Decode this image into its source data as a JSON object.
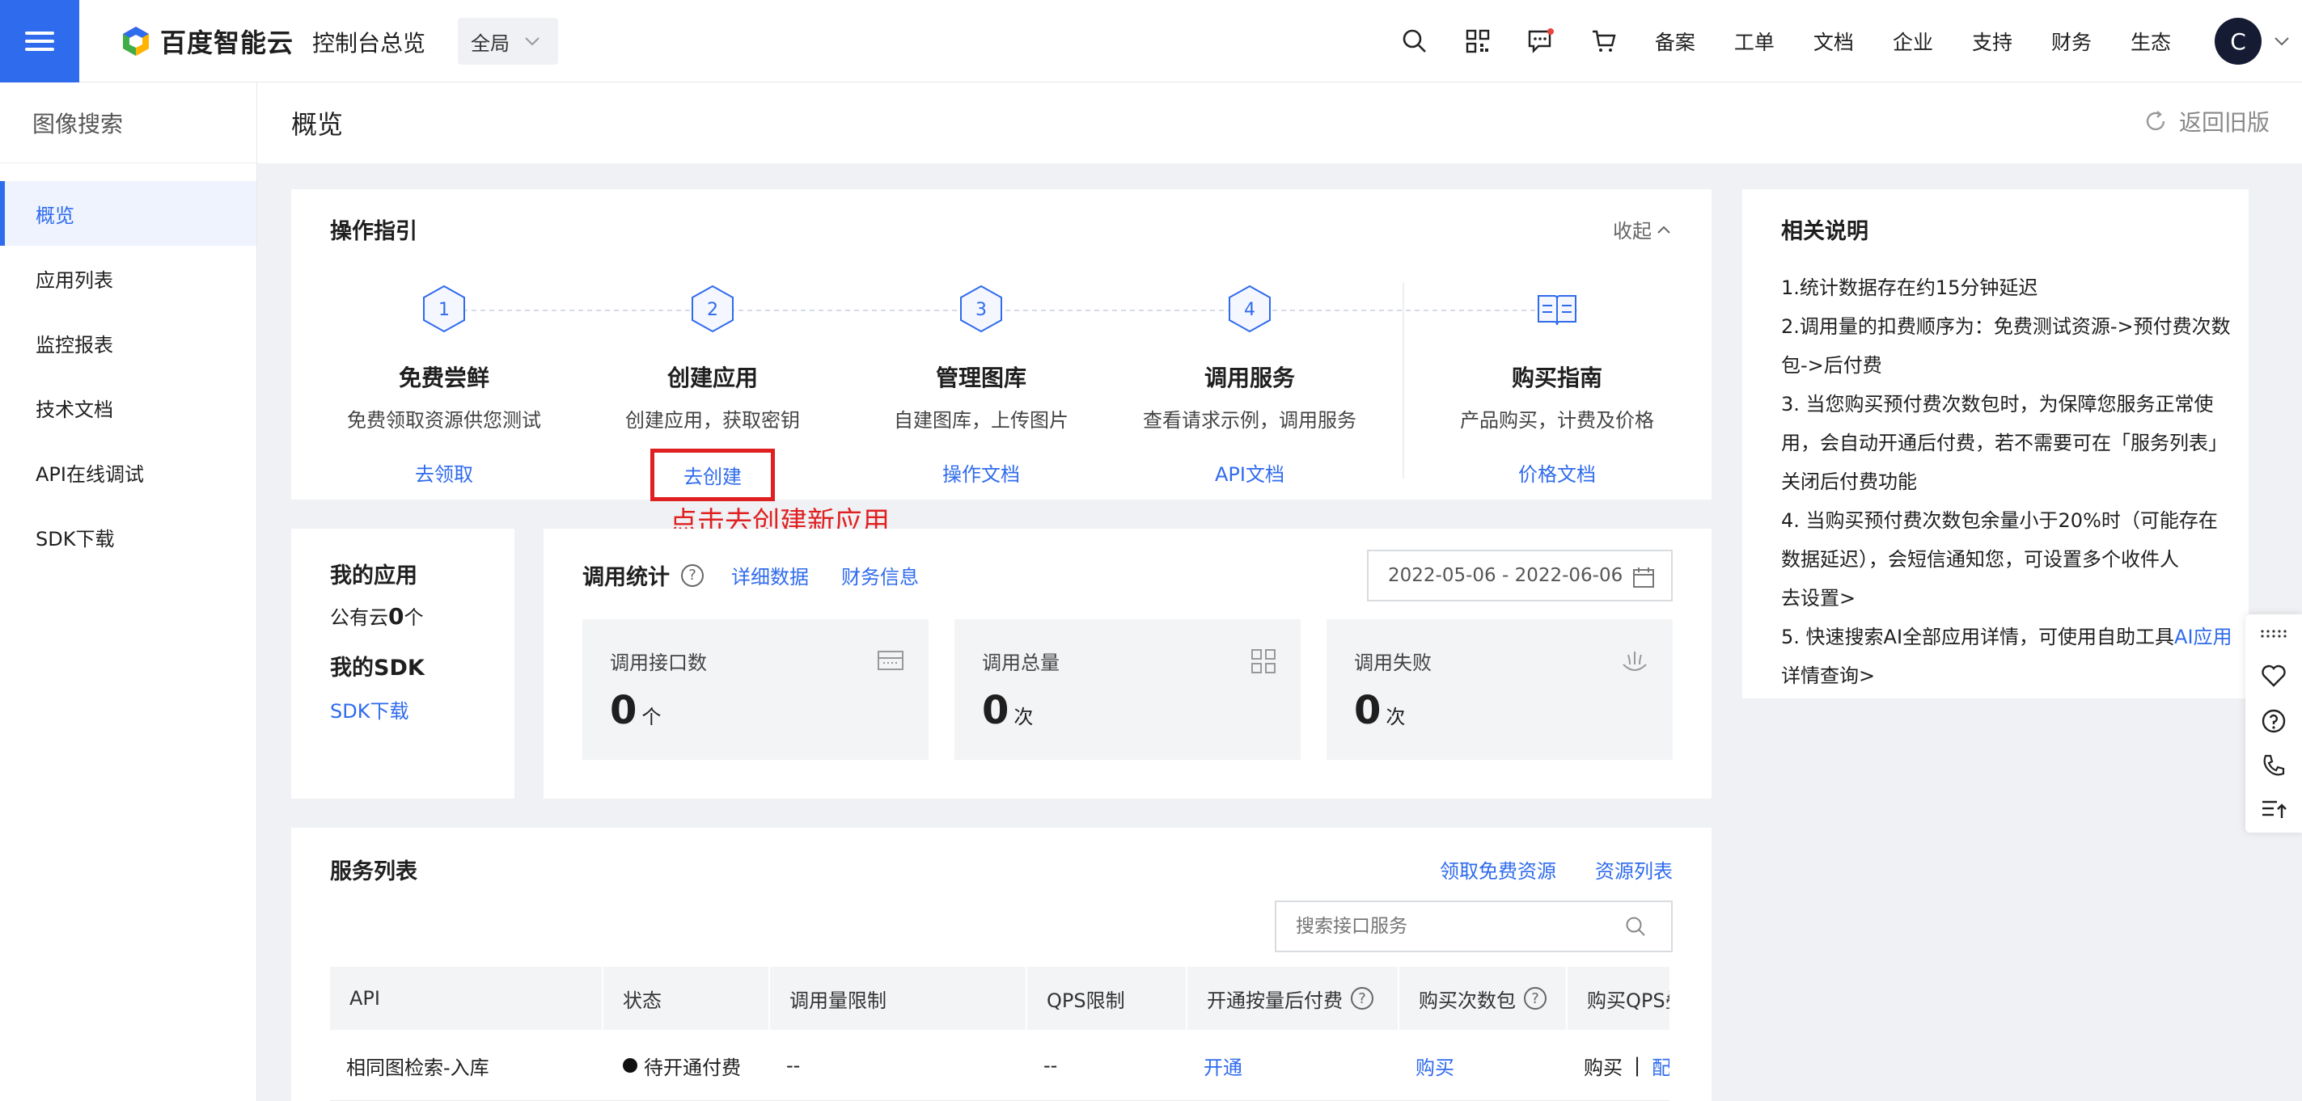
{
  "topbar": {
    "brand": "百度智能云",
    "console_label": "控制台总览",
    "region": "全局",
    "nav_links": [
      "备案",
      "工单",
      "文档",
      "企业",
      "支持",
      "财务",
      "生态"
    ],
    "avatar_letter": "C",
    "accent": "#2f6bed"
  },
  "sidebar": {
    "title": "图像搜索",
    "items": [
      {
        "label": "概览",
        "active": true
      },
      {
        "label": "应用列表"
      },
      {
        "label": "监控报表"
      },
      {
        "label": "技术文档"
      },
      {
        "label": "API在线调试"
      },
      {
        "label": "SDK下载"
      }
    ]
  },
  "page": {
    "title": "概览",
    "back_old": "返回旧版"
  },
  "guide": {
    "title": "操作指引",
    "collapse": "收起",
    "steps": [
      {
        "num": "1",
        "name": "免费尝鲜",
        "desc": "免费领取资源供您测试",
        "link": "去领取"
      },
      {
        "num": "2",
        "name": "创建应用",
        "desc": "创建应用，获取密钥",
        "link": "去创建"
      },
      {
        "num": "3",
        "name": "管理图库",
        "desc": "自建图库，上传图片",
        "link": "操作文档"
      },
      {
        "num": "4",
        "name": "调用服务",
        "desc": "查看请求示例，调用服务",
        "link": "API文档"
      }
    ],
    "purchase": {
      "name": "购买指南",
      "desc": "产品购买，计费及价格",
      "link": "价格文档"
    },
    "annotation": "点击去创建新应用"
  },
  "myapps": {
    "title": "我的应用",
    "public_cloud_prefix": "公有云",
    "public_cloud_count": "0",
    "public_cloud_unit": "个",
    "sdk_title": "我的SDK",
    "sdk_link": "SDK下载"
  },
  "stats": {
    "title": "调用统计",
    "detail_link": "详细数据",
    "finance_link": "财务信息",
    "date_range": "2022-05-06 - 2022-06-06",
    "boxes": [
      {
        "label": "调用接口数",
        "value": "0",
        "unit": "个"
      },
      {
        "label": "调用总量",
        "value": "0",
        "unit": "次"
      },
      {
        "label": "调用失败",
        "value": "0",
        "unit": "次"
      }
    ]
  },
  "notes": {
    "title": "相关说明",
    "lines": [
      "1.统计数据存在约15分钟延迟",
      "2.调用量的扣费顺序为：免费测试资源->预付费次数",
      "包->后付费",
      "3. 当您购买预付费次数包时，为保障您服务正常使",
      "用，会自动开通后付费，若不需要可在「服务列表」",
      "关闭后付费功能",
      "4. 当购买预付费次数包余量小于20%时（可能存在",
      "数据延迟），会短信通知您，可设置多个收件人"
    ],
    "settings_link": "去设置>",
    "line5_text": "5. 快速搜索AI全部应用详情，可使用自助工具",
    "line5_link_a": "AI应用",
    "line5_link_b": "详情查询>"
  },
  "services": {
    "title": "服务列表",
    "free_link": "领取免费资源",
    "resource_link": "资源列表",
    "search_placeholder": "搜索接口服务",
    "columns": [
      "API",
      "状态",
      "调用量限制",
      "QPS限制",
      "开通按量后付费",
      "购买次数包",
      "购买QPS叠"
    ],
    "rows": [
      {
        "api": "相同图检索-入库",
        "status": "待开通付费",
        "limit": "--",
        "qps": "--",
        "open": "开通",
        "buy": "购买",
        "buy_qps_a": "购买",
        "buy_qps_sep": "|",
        "buy_qps_b": "配"
      }
    ]
  }
}
